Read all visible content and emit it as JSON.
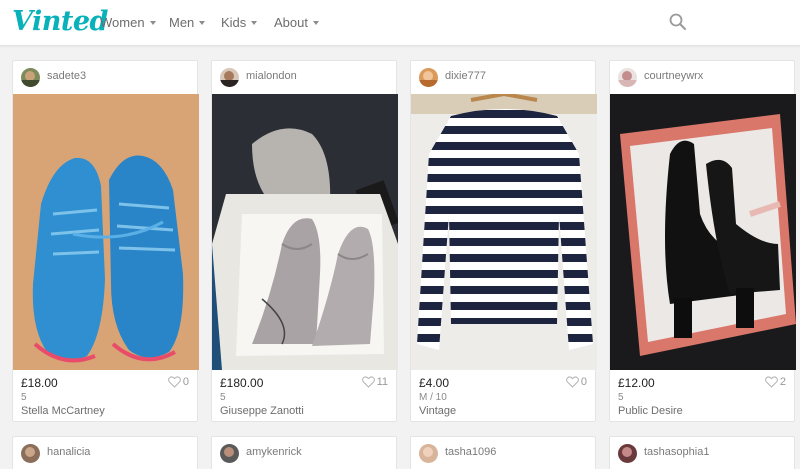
{
  "header": {
    "logo": "Vinted",
    "nav": [
      {
        "label": "Women"
      },
      {
        "label": "Men"
      },
      {
        "label": "Kids"
      },
      {
        "label": "About"
      }
    ]
  },
  "items": [
    {
      "username": "sadete3",
      "price": "£18.00",
      "size": "5",
      "brand": "Stella McCartney",
      "favourites": "0"
    },
    {
      "username": "mialondon",
      "price": "£180.00",
      "size": "5",
      "brand": "Giuseppe Zanotti",
      "favourites": "11"
    },
    {
      "username": "dixie777",
      "price": "£4.00",
      "size": "M / 10",
      "brand": "Vintage",
      "favourites": "0"
    },
    {
      "username": "courtneywrx",
      "price": "£12.00",
      "size": "5",
      "brand": "Public Desire",
      "favourites": "2"
    }
  ],
  "next_row": [
    {
      "username": "hanalicia"
    },
    {
      "username": "amykenrick"
    },
    {
      "username": "tasha1096"
    },
    {
      "username": "tashasophia1"
    }
  ],
  "colors": {
    "brand": "#09b1ba",
    "background": "#f2f2f2"
  }
}
